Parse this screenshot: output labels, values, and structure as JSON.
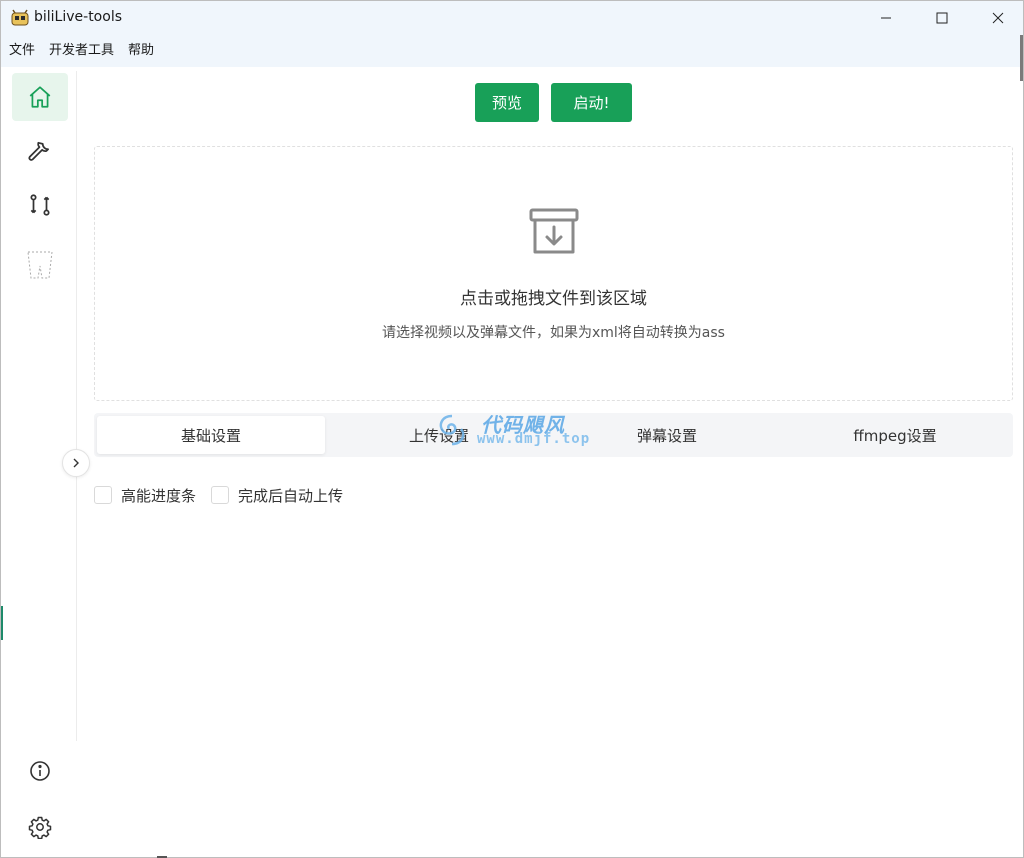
{
  "window": {
    "title": "biliLive-tools",
    "controls": [
      "minimize",
      "maximize",
      "close"
    ]
  },
  "menubar": {
    "items": [
      "文件",
      "开发者工具",
      "帮助"
    ]
  },
  "sidebar": {
    "items": [
      {
        "icon": "home-icon",
        "active": true
      },
      {
        "icon": "wrench-icon",
        "active": false
      },
      {
        "icon": "git-compare-icon",
        "active": false
      },
      {
        "icon": "dashed-shape-icon",
        "active": false
      }
    ],
    "bottom_items": [
      {
        "icon": "info-icon"
      },
      {
        "icon": "settings-gear-icon"
      }
    ],
    "collapse_icon": "chevron-right-icon"
  },
  "actions": {
    "preview_label": "预览",
    "start_label": "启动!"
  },
  "dropzone": {
    "icon": "archive-download-icon",
    "title": "点击或拖拽文件到该区域",
    "hint": "请选择视频以及弹幕文件，如果为xml将自动转换为ass"
  },
  "tabs": {
    "items": [
      "基础设置",
      "上传设置",
      "弹幕设置",
      "ffmpeg设置"
    ],
    "active_index": 0
  },
  "options": {
    "progress_bar_label": "高能进度条",
    "auto_upload_label": "完成后自动上传"
  },
  "watermark": {
    "title": "代码飓风",
    "url": "www.dmjf.top"
  },
  "colors": {
    "accent": "#18a058",
    "active_bg": "#e7f5ec",
    "titlebar_bg": "#f0f6fc"
  }
}
